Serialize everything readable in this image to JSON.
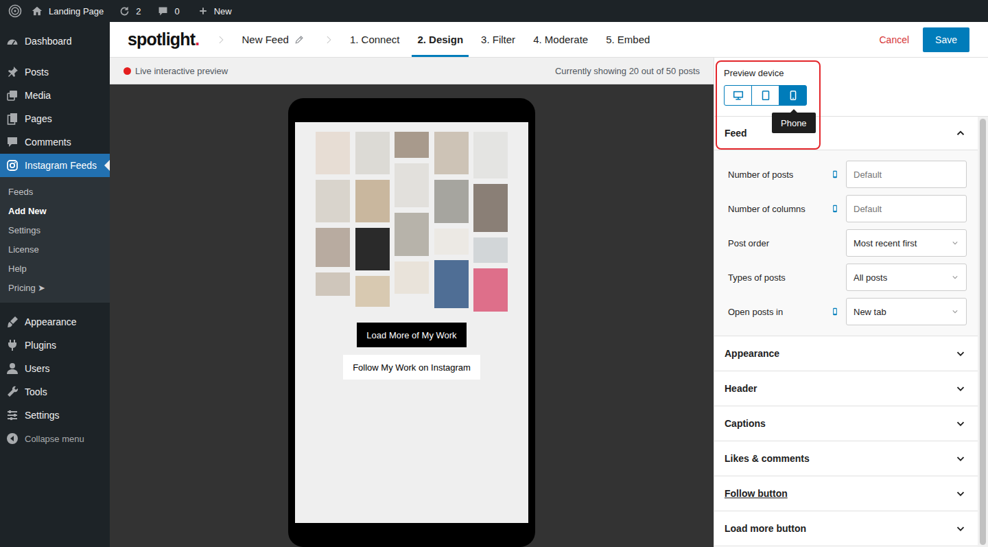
{
  "admin_bar": {
    "site": "Landing Page",
    "updates": "2",
    "comments": "0",
    "new": "New"
  },
  "sidebar": {
    "items": [
      {
        "label": "Dashboard",
        "kind": "item",
        "selected": false
      },
      {
        "label": "Posts",
        "kind": "item",
        "selected": false
      },
      {
        "label": "Media",
        "kind": "item",
        "selected": false
      },
      {
        "label": "Pages",
        "kind": "item",
        "selected": false
      },
      {
        "label": "Comments",
        "kind": "item",
        "selected": false
      },
      {
        "label": "Instagram Feeds",
        "kind": "item",
        "selected": true
      },
      {
        "label": "Feeds",
        "kind": "sub",
        "selected": false
      },
      {
        "label": "Add New",
        "kind": "sub",
        "selected": true
      },
      {
        "label": "Settings",
        "kind": "sub",
        "selected": false
      },
      {
        "label": "License",
        "kind": "sub",
        "selected": false
      },
      {
        "label": "Help",
        "kind": "sub",
        "selected": false
      },
      {
        "label": "Pricing ➤",
        "kind": "sub",
        "selected": false
      },
      {
        "label": "Appearance",
        "kind": "item",
        "selected": false
      },
      {
        "label": "Plugins",
        "kind": "item",
        "selected": false
      },
      {
        "label": "Users",
        "kind": "item",
        "selected": false
      },
      {
        "label": "Tools",
        "kind": "item",
        "selected": false
      },
      {
        "label": "Settings",
        "kind": "item",
        "selected": false
      },
      {
        "label": "Collapse menu",
        "kind": "collapse",
        "selected": false
      }
    ]
  },
  "editor": {
    "logo": "spotlight",
    "logo_dot": ".",
    "feed_name": "New Feed",
    "steps": [
      {
        "label": "1. Connect",
        "selected": false
      },
      {
        "label": "2. Design",
        "selected": true
      },
      {
        "label": "3. Filter",
        "selected": false
      },
      {
        "label": "4. Moderate",
        "selected": false
      },
      {
        "label": "5. Embed",
        "selected": false
      }
    ],
    "cancel": "Cancel",
    "save": "Save"
  },
  "preview": {
    "live": "Live interactive preview",
    "count": "Currently showing 20 out of 50 posts",
    "load_more": "Load More of My Work",
    "follow": "Follow My Work on Instagram"
  },
  "settings": {
    "device_label": "Preview device",
    "highlighted": true,
    "devices": [
      {
        "kind": "desktop",
        "selected": false
      },
      {
        "kind": "tablet",
        "selected": false
      },
      {
        "kind": "phone",
        "selected": true
      }
    ],
    "tooltip": "Phone",
    "sections": [
      {
        "title": "Feed",
        "expanded": true,
        "hovered": false,
        "fields": [
          {
            "label": "Number of posts",
            "responsive": true,
            "kind": "input",
            "placeholder": "Default"
          },
          {
            "label": "Number of columns",
            "responsive": true,
            "kind": "input",
            "placeholder": "Default"
          },
          {
            "label": "Post order",
            "responsive": false,
            "kind": "select",
            "value": "Most recent first"
          },
          {
            "label": "Types of posts",
            "responsive": false,
            "kind": "select",
            "value": "All posts"
          },
          {
            "label": "Open posts in",
            "responsive": true,
            "kind": "select",
            "value": "New tab"
          }
        ]
      },
      {
        "title": "Appearance",
        "expanded": false,
        "hovered": false
      },
      {
        "title": "Header",
        "expanded": false,
        "hovered": false
      },
      {
        "title": "Captions",
        "expanded": false,
        "hovered": false
      },
      {
        "title": "Likes & comments",
        "expanded": false,
        "hovered": false
      },
      {
        "title": "Follow button",
        "expanded": false,
        "hovered": true
      },
      {
        "title": "Load more button",
        "expanded": false,
        "hovered": false
      }
    ]
  }
}
